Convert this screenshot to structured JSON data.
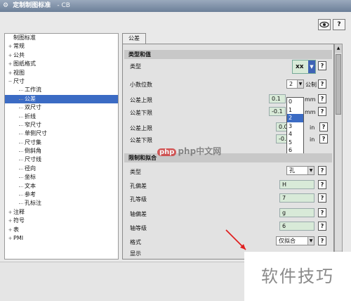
{
  "window": {
    "title": "定制制图标准",
    "subtitle": "- CB"
  },
  "toolbar": {
    "icons": [
      "view-icon",
      "help-icon"
    ]
  },
  "tree": {
    "items": [
      {
        "label": "制图标准",
        "level": 0,
        "expander": ""
      },
      {
        "label": "常规",
        "level": 1,
        "expander": "+"
      },
      {
        "label": "公共",
        "level": 1,
        "expander": "+"
      },
      {
        "label": "图纸格式",
        "level": 1,
        "expander": "+"
      },
      {
        "label": "视图",
        "level": 1,
        "expander": "+"
      },
      {
        "label": "尺寸",
        "level": 1,
        "expander": "−"
      },
      {
        "label": "工作流",
        "level": 2,
        "expander": ""
      },
      {
        "label": "公差",
        "level": 2,
        "expander": "",
        "selected": true
      },
      {
        "label": "双尺寸",
        "level": 2,
        "expander": ""
      },
      {
        "label": "折线",
        "level": 2,
        "expander": ""
      },
      {
        "label": "窄尺寸",
        "level": 2,
        "expander": ""
      },
      {
        "label": "单侧尺寸",
        "level": 2,
        "expander": ""
      },
      {
        "label": "尺寸集",
        "level": 2,
        "expander": ""
      },
      {
        "label": "倒斜角",
        "level": 2,
        "expander": ""
      },
      {
        "label": "尺寸线",
        "level": 2,
        "expander": ""
      },
      {
        "label": "径向",
        "level": 2,
        "expander": ""
      },
      {
        "label": "坐标",
        "level": 2,
        "expander": ""
      },
      {
        "label": "文本",
        "level": 2,
        "expander": ""
      },
      {
        "label": "参考",
        "level": 2,
        "expander": ""
      },
      {
        "label": "孔标注",
        "level": 2,
        "expander": ""
      },
      {
        "label": "注释",
        "level": 1,
        "expander": "+"
      },
      {
        "label": "符号",
        "level": 1,
        "expander": "+"
      },
      {
        "label": "表",
        "level": 1,
        "expander": "+"
      },
      {
        "label": "PMI",
        "level": 1,
        "expander": "+"
      }
    ]
  },
  "tab": {
    "label": "公差"
  },
  "section1": {
    "title": "类型和值",
    "type_label": "类型",
    "type_value": "xx",
    "decimals_label": "小数位数",
    "decimals_value": "2",
    "decimals_unit": "公制",
    "upper_label": "公差上限",
    "upper_value": "0.1",
    "upper_unit": "mm",
    "lower_label": "公差下限",
    "lower_value": "-0.1",
    "lower_unit": "mm",
    "upper_in_label": "公差上限",
    "upper_in_value": "0.00",
    "upper_in_unit": "in",
    "lower_in_label": "公差下限",
    "lower_in_value": "-0.0",
    "lower_in_unit": "in",
    "dropdown_options": [
      "0",
      "1",
      "2",
      "3",
      "4",
      "5",
      "6"
    ],
    "dropdown_selected": "2"
  },
  "section2": {
    "title": "限制和拟合",
    "type_label": "类型",
    "type_value": "孔",
    "hole_dev_label": "孔偏差",
    "hole_dev_value": "H",
    "hole_grade_label": "孔等级",
    "hole_grade_value": "7",
    "shaft_dev_label": "轴偏差",
    "shaft_dev_value": "g",
    "shaft_grade_label": "轴等级",
    "shaft_grade_value": "6",
    "format_label": "格式",
    "format_value": "仅拟合",
    "display_label": "显示"
  },
  "help_symbol": "?",
  "watermarks": {
    "site": "php中文网",
    "site_logo": "php",
    "corner": "软件技巧"
  },
  "colors": {
    "selection": "#3b6bc4",
    "field_bg": "#d8ead8",
    "arrow": "#e02020"
  }
}
